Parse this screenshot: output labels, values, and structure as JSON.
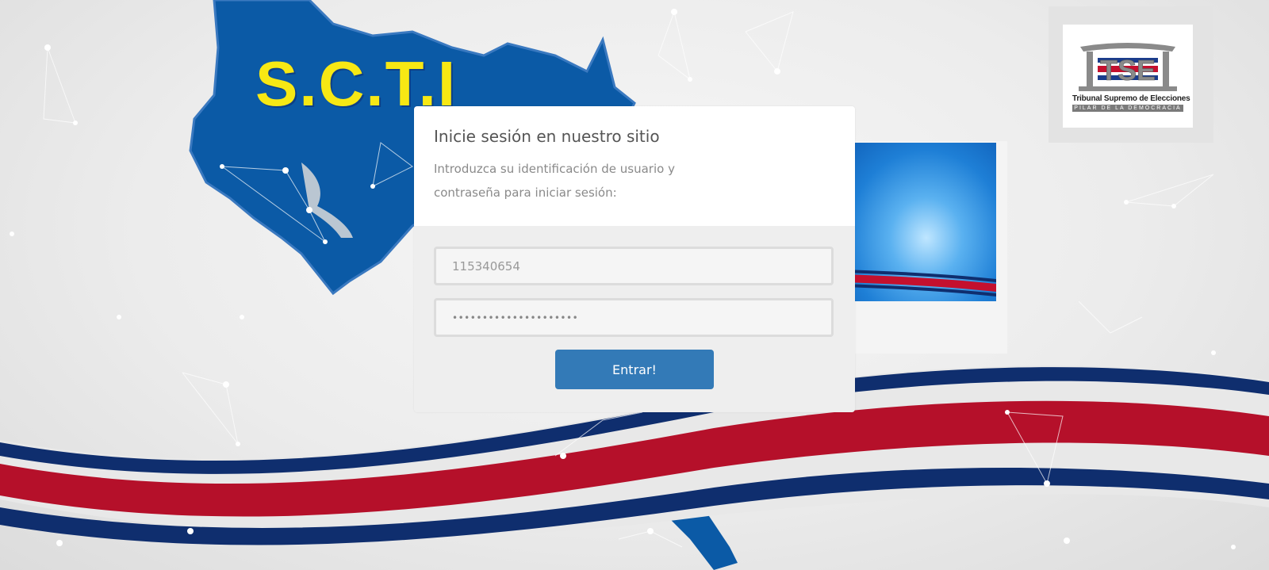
{
  "brand": {
    "text": "S.C.T.I",
    "color": "#f7e814",
    "map_color": "#0b5aa6"
  },
  "logo": {
    "mark": "TSE",
    "line1": "Tribunal Supremo de Elecciones",
    "line2": "PILAR DE LA DEMOCRACIA"
  },
  "login": {
    "title": "Inicie sesión en nuestro sitio",
    "description": "Introduzca su identificación de usuario y contraseña para iniciar sesión:",
    "username_value": "115340654",
    "password_value": "•••••••••••••••••••••",
    "submit_label": "Entrar!"
  },
  "colors": {
    "button": "#337ab7",
    "flag_red": "#c4102e",
    "flag_blue": "#0f2e6e"
  }
}
